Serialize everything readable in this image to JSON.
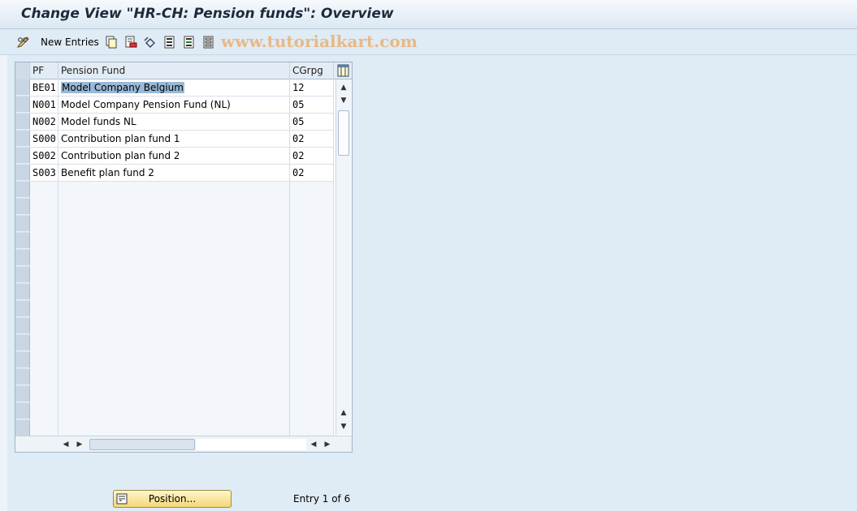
{
  "title": "Change View \"HR-CH: Pension funds\": Overview",
  "toolbar": {
    "new_entries_label": "New Entries",
    "watermark": "www.tutorialkart.com"
  },
  "table": {
    "headers": {
      "pf": "PF",
      "pension_fund": "Pension Fund",
      "cgrpg": "CGrpg"
    },
    "rows": [
      {
        "pf": "BE01",
        "pension_fund": "Model Company Belgium",
        "cgrpg": "12"
      },
      {
        "pf": "N001",
        "pension_fund": "Model Company Pension Fund (NL)",
        "cgrpg": "05"
      },
      {
        "pf": "N002",
        "pension_fund": "Model funds NL",
        "cgrpg": "05"
      },
      {
        "pf": "S000",
        "pension_fund": "Contribution plan fund 1",
        "cgrpg": "02"
      },
      {
        "pf": "S002",
        "pension_fund": "Contribution plan fund 2",
        "cgrpg": "02"
      },
      {
        "pf": "S003",
        "pension_fund": "Benefit plan fund 2",
        "cgrpg": "02"
      }
    ]
  },
  "footer": {
    "position_label": "Position...",
    "entry_info": "Entry 1 of 6"
  },
  "colors": {
    "highlight": "#9ab8d8",
    "position_button": "#f3d77a",
    "background": "#dfebf5"
  }
}
